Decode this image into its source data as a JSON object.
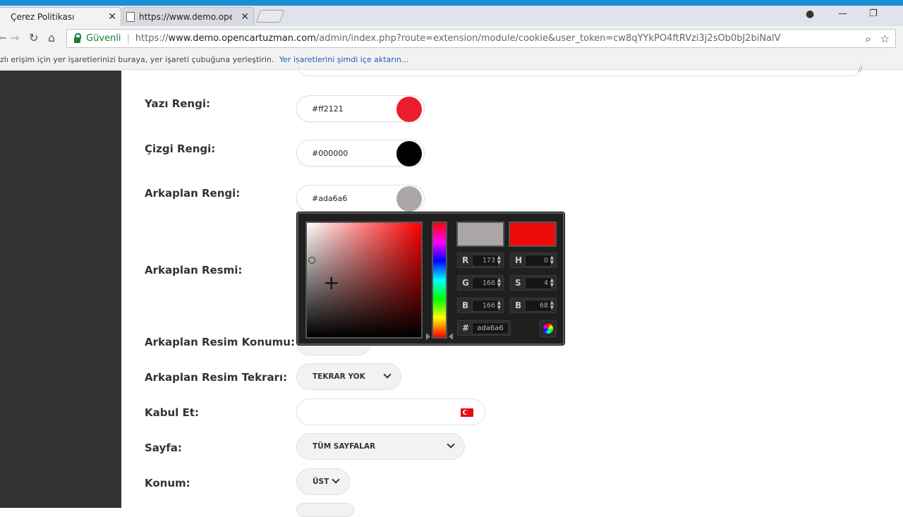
{
  "browser": {
    "tabs": [
      {
        "title": "Çerez Politikası",
        "close": "✕"
      },
      {
        "title": "https://www.demo.openc",
        "close": "✕"
      }
    ],
    "window_controls": {
      "minimize": "—",
      "restore": "❐",
      "close": "✕"
    },
    "nav": {
      "back": "←",
      "forward": "→",
      "reload": "↻",
      "home": "⌂"
    },
    "address": {
      "secure_label": "Güvenli",
      "separator": "|",
      "url_protocol": "https://",
      "url_host": "www.demo.opencartuzman.com",
      "url_path": "/admin/index.php?route=extension/module/cookie&user_token=cw8qYYkPO4ftRVzi3j2sOb0bJ2biNalV"
    },
    "bookmarks": {
      "hint": "zlı erişim için yer işaretlerinizi buraya, yer işareti çubuğuna yerleştirin.",
      "import_link": "Yer işaretlerini şimdi içe aktarın..."
    }
  },
  "form": {
    "text_color": {
      "label": "Yazı Rengi:",
      "value": "#ff2121",
      "swatch": "#ec1c2c"
    },
    "line_color": {
      "label": "Çizgi Rengi:",
      "value": "#000000",
      "swatch": "#000000"
    },
    "bg_color": {
      "label": "Arkaplan Rengi:",
      "value": "#ada6a6",
      "swatch": "#ada6a6"
    },
    "bg_image": {
      "label": "Arkaplan Resmi:"
    },
    "bg_image_position": {
      "label": "Arkaplan Resim Konumu:"
    },
    "bg_image_repeat": {
      "label": "Arkaplan Resim Tekrarı:",
      "value": "TEKRAR YOK"
    },
    "accept": {
      "label": "Kabul Et:",
      "value": ""
    },
    "page": {
      "label": "Sayfa:",
      "value": "TÜM SAYFALAR"
    },
    "position": {
      "label": "Konum:",
      "value": "ÜST"
    }
  },
  "color_picker": {
    "current_color": "#ada6a6",
    "new_color": "#ff0000",
    "r": {
      "label": "R",
      "value": "173"
    },
    "g": {
      "label": "G",
      "value": "166"
    },
    "b": {
      "label": "B",
      "value": "166"
    },
    "h": {
      "label": "H",
      "value": "0"
    },
    "s": {
      "label": "S",
      "value": "4"
    },
    "v": {
      "label": "B",
      "value": "68"
    },
    "hex": {
      "label": "#",
      "value": "ada6a6"
    }
  }
}
